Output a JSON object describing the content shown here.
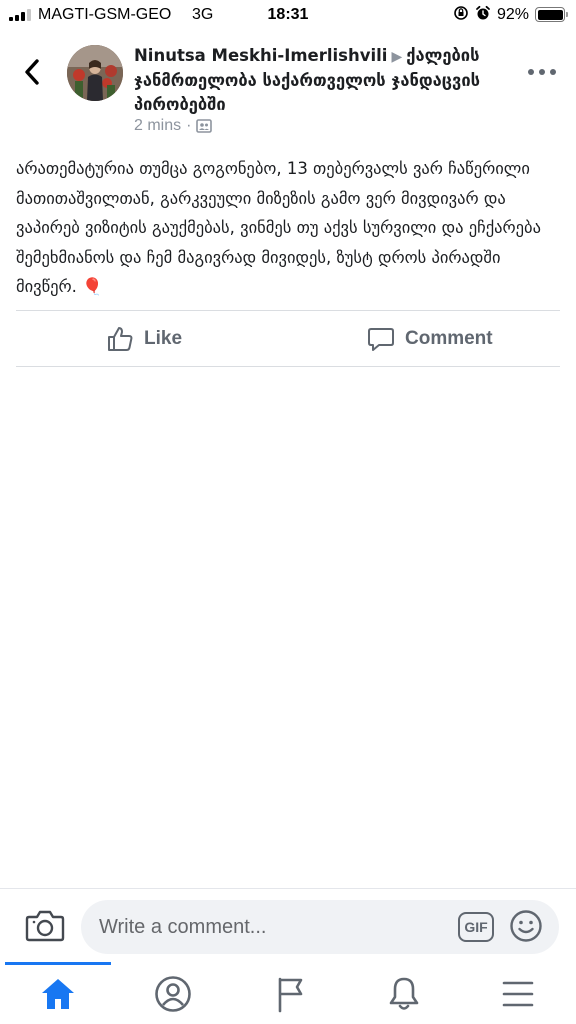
{
  "status_bar": {
    "carrier": "MAGTI-GSM-GEO",
    "network": "3G",
    "time": "18:31",
    "battery": "92%",
    "icons": [
      "orientation-lock-icon",
      "alarm-icon"
    ]
  },
  "header": {
    "back_icon": "chevron-left-icon",
    "author": "Ninutsa Meskhi-Imerlishvili",
    "separator_icon": "triangle-right-icon",
    "group": "ქალების ჯანმრთელობა საქართველოს ჯანდაცვის პირობებში",
    "timestamp": "2 mins",
    "audience_icon": "group-audience-icon",
    "more_icon": "more-horizontal-icon"
  },
  "post": {
    "text": "არათემატურია თუმცა გოგონებო, 13 თებერვალს ვარ ჩაწერილი მათითაშვილთან, გარკვეული მიზეზის გამო ვერ მივდივარ და ვაპირებ ვიზიტის გაუქმებას, ვინმეს თუ აქვს სურვილი და ეჩქარება შემეხმიანოს და ჩემ მაგივრად მივიდეს, ზუსტ დროს პირადში მივწერ. 🎈"
  },
  "actions": {
    "like_label": "Like",
    "comment_label": "Comment"
  },
  "composer": {
    "placeholder": "Write a comment...",
    "gif_label": "GIF"
  },
  "tabs": [
    "home-icon",
    "profile-icon",
    "pages-flag-icon",
    "notifications-bell-icon",
    "menu-icon"
  ],
  "colors": {
    "accent": "#1877f2",
    "text_primary": "#1c1e21",
    "text_secondary": "#606770",
    "meta_gray": "#8d949e",
    "balloon": "#e8302f"
  }
}
